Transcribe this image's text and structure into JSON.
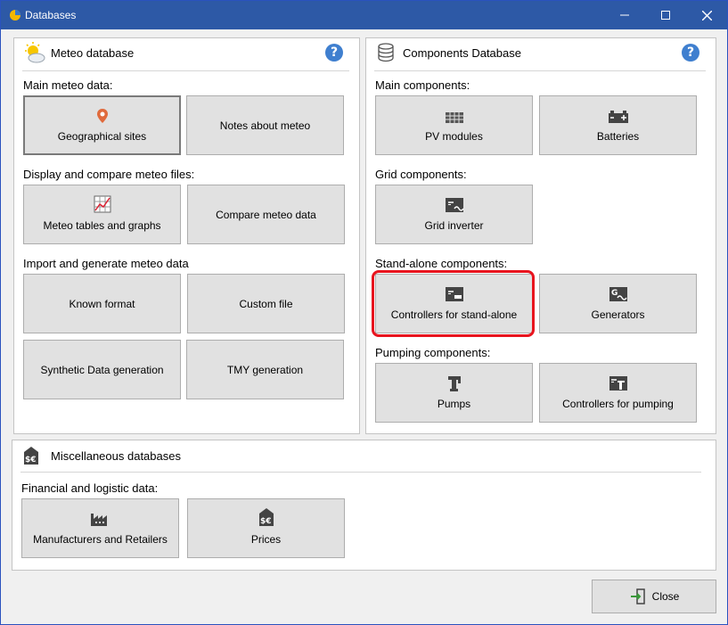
{
  "window": {
    "title": "Databases"
  },
  "meteo": {
    "title": "Meteo database",
    "sections": {
      "main": "Main meteo data:",
      "display": "Display and compare meteo files:",
      "import": "Import and generate meteo data"
    },
    "buttons": {
      "geo": "Geographical sites",
      "notes": "Notes about meteo",
      "tables": "Meteo tables and graphs",
      "compare": "Compare meteo data",
      "known": "Known format",
      "custom": "Custom file",
      "synthetic": "Synthetic Data generation",
      "tmy": "TMY generation"
    }
  },
  "components": {
    "title": "Components Database",
    "sections": {
      "main": "Main components:",
      "grid": "Grid components:",
      "standalone": "Stand-alone components:",
      "pumping": "Pumping components:"
    },
    "buttons": {
      "pv": "PV modules",
      "batteries": "Batteries",
      "inverter": "Grid inverter",
      "controllers_sa": "Controllers for stand-alone",
      "generators": "Generators",
      "pumps": "Pumps",
      "controllers_pump": "Controllers for pumping"
    }
  },
  "misc": {
    "title": "Miscellaneous databases",
    "section": "Financial and logistic data:",
    "buttons": {
      "manufacturers": "Manufacturers and Retailers",
      "prices": "Prices"
    }
  },
  "footer": {
    "close": "Close"
  },
  "colors": {
    "highlight": "#e8141e",
    "titlebar": "#2d59a6",
    "help": "#3f7fcf"
  }
}
